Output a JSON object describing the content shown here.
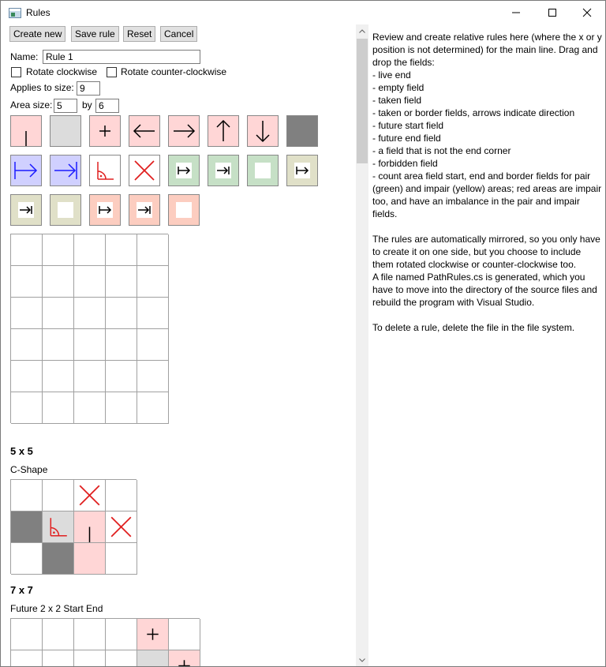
{
  "window": {
    "title": "Rules",
    "minimize_icon": "minimize-icon",
    "maximize_icon": "maximize-icon",
    "close_icon": "close-icon"
  },
  "toolbar": {
    "create_new": "Create new",
    "save_rule": "Save rule",
    "reset": "Reset",
    "cancel": "Cancel"
  },
  "form": {
    "name_label": "Name:",
    "name_value": "Rule 1",
    "rotate_cw_label": "Rotate clockwise",
    "rotate_cw_checked": false,
    "rotate_ccw_label": "Rotate counter-clockwise",
    "rotate_ccw_checked": false,
    "applies_label": "Applies to size:",
    "applies_value": "9",
    "area_size_label": "Area size:",
    "area_width": "5",
    "by_label": "by",
    "area_height": "6"
  },
  "palette": [
    {
      "name": "live-end",
      "bg": "#ffd6d6",
      "icon": "vertical-line-icon"
    },
    {
      "name": "empty-field",
      "bg": "#dcdcdc",
      "icon": "none"
    },
    {
      "name": "taken-field",
      "bg": "#ffd6d6",
      "icon": "plus-icon"
    },
    {
      "name": "taken-left",
      "bg": "#ffd6d6",
      "icon": "arrow-left-icon"
    },
    {
      "name": "taken-right",
      "bg": "#ffd6d6",
      "icon": "arrow-right-icon"
    },
    {
      "name": "taken-up",
      "bg": "#ffd6d6",
      "icon": "arrow-up-icon"
    },
    {
      "name": "taken-down",
      "bg": "#ffd6d6",
      "icon": "arrow-down-icon"
    },
    {
      "name": "border-field",
      "bg": "#808080",
      "icon": "none"
    },
    {
      "name": "future-start",
      "bg": "#d0d0ff",
      "icon": "future-start-icon"
    },
    {
      "name": "future-end",
      "bg": "#d0d0ff",
      "icon": "future-end-icon"
    },
    {
      "name": "not-end-corner",
      "bg": "#ffffff",
      "icon": "corner-icon"
    },
    {
      "name": "forbidden",
      "bg": "#ffffff",
      "icon": "cross-icon"
    },
    {
      "name": "count-start-green",
      "bg": "#c6e0c6",
      "icon": "count-start-icon"
    },
    {
      "name": "count-end-green",
      "bg": "#c6e0c6",
      "icon": "count-end-icon"
    },
    {
      "name": "count-border-green",
      "bg": "#c6e0c6",
      "icon": "count-border-icon"
    },
    {
      "name": "count-start-yellow",
      "bg": "#e0e0c8",
      "icon": "count-start-icon"
    },
    {
      "name": "count-end-yellow",
      "bg": "#e0e0c8",
      "icon": "count-end-icon"
    },
    {
      "name": "count-border-yellow",
      "bg": "#e0e0c8",
      "icon": "count-border-icon"
    },
    {
      "name": "count-start-red",
      "bg": "#fccdc0",
      "icon": "count-start-icon"
    },
    {
      "name": "count-end-red",
      "bg": "#fccdc0",
      "icon": "count-end-icon"
    },
    {
      "name": "count-border-red",
      "bg": "#fccdc0",
      "icon": "count-border-icon"
    }
  ],
  "editor_grid": {
    "cols": 5,
    "rows": 6
  },
  "rule_groups": [
    {
      "size": "5 x 5",
      "rule_name": "C-Shape",
      "cells": [
        [
          {
            "bg": "#ffffff"
          },
          {
            "bg": "#ffffff"
          },
          {
            "bg": "#ffffff",
            "icon": "cross-icon"
          },
          {
            "bg": "#ffffff"
          }
        ],
        [
          {
            "bg": "#808080"
          },
          {
            "bg": "#dcdcdc",
            "icon": "corner-icon"
          },
          {
            "bg": "#ffd6d6",
            "icon": "vertical-line-icon"
          },
          {
            "bg": "#ffffff",
            "icon": "cross-icon"
          }
        ],
        [
          {
            "bg": "#ffffff"
          },
          {
            "bg": "#808080"
          },
          {
            "bg": "#ffd6d6"
          },
          {
            "bg": "#ffffff"
          }
        ]
      ]
    },
    {
      "size": "7 x 7",
      "rule_name": "Future 2 x 2 Start End",
      "cells": [
        [
          {
            "bg": "#ffffff"
          },
          {
            "bg": "#ffffff"
          },
          {
            "bg": "#ffffff"
          },
          {
            "bg": "#ffffff"
          },
          {
            "bg": "#ffd6d6",
            "icon": "plus-icon"
          },
          {
            "bg": "#ffffff"
          }
        ],
        [
          {
            "bg": "#ffffff"
          },
          {
            "bg": "#ffffff"
          },
          {
            "bg": "#ffffff"
          },
          {
            "bg": "#ffffff"
          },
          {
            "bg": "#dcdcdc"
          },
          {
            "bg": "#ffd6d6",
            "icon": "plus-icon"
          }
        ]
      ]
    }
  ],
  "help_text": "Review and create relative rules here (where the x or y position is not determined) for the main line. Drag and drop the fields:\n- live end\n- empty field\n- taken field\n- taken or border fields, arrows indicate direction\n- future start field\n- future end field\n- a field that is not the end corner\n- forbidden field\n- count area field start, end and border fields for pair (green) and impair (yellow) areas; red areas are impair too, and have an imbalance in the pair and impair fields.\n\nThe rules are automatically mirrored, so you only have to create it on one side, but you choose to include them rotated clockwise or counter-clockwise too.\nA file named PathRules.cs is generated, which you have to move into the directory of the source files and rebuild the program with Visual Studio.\n\nTo delete a rule, delete the file in the file system.",
  "colors": {
    "red_icon": "#e02020",
    "blue_icon": "#1a1aff",
    "black_icon": "#000000"
  }
}
